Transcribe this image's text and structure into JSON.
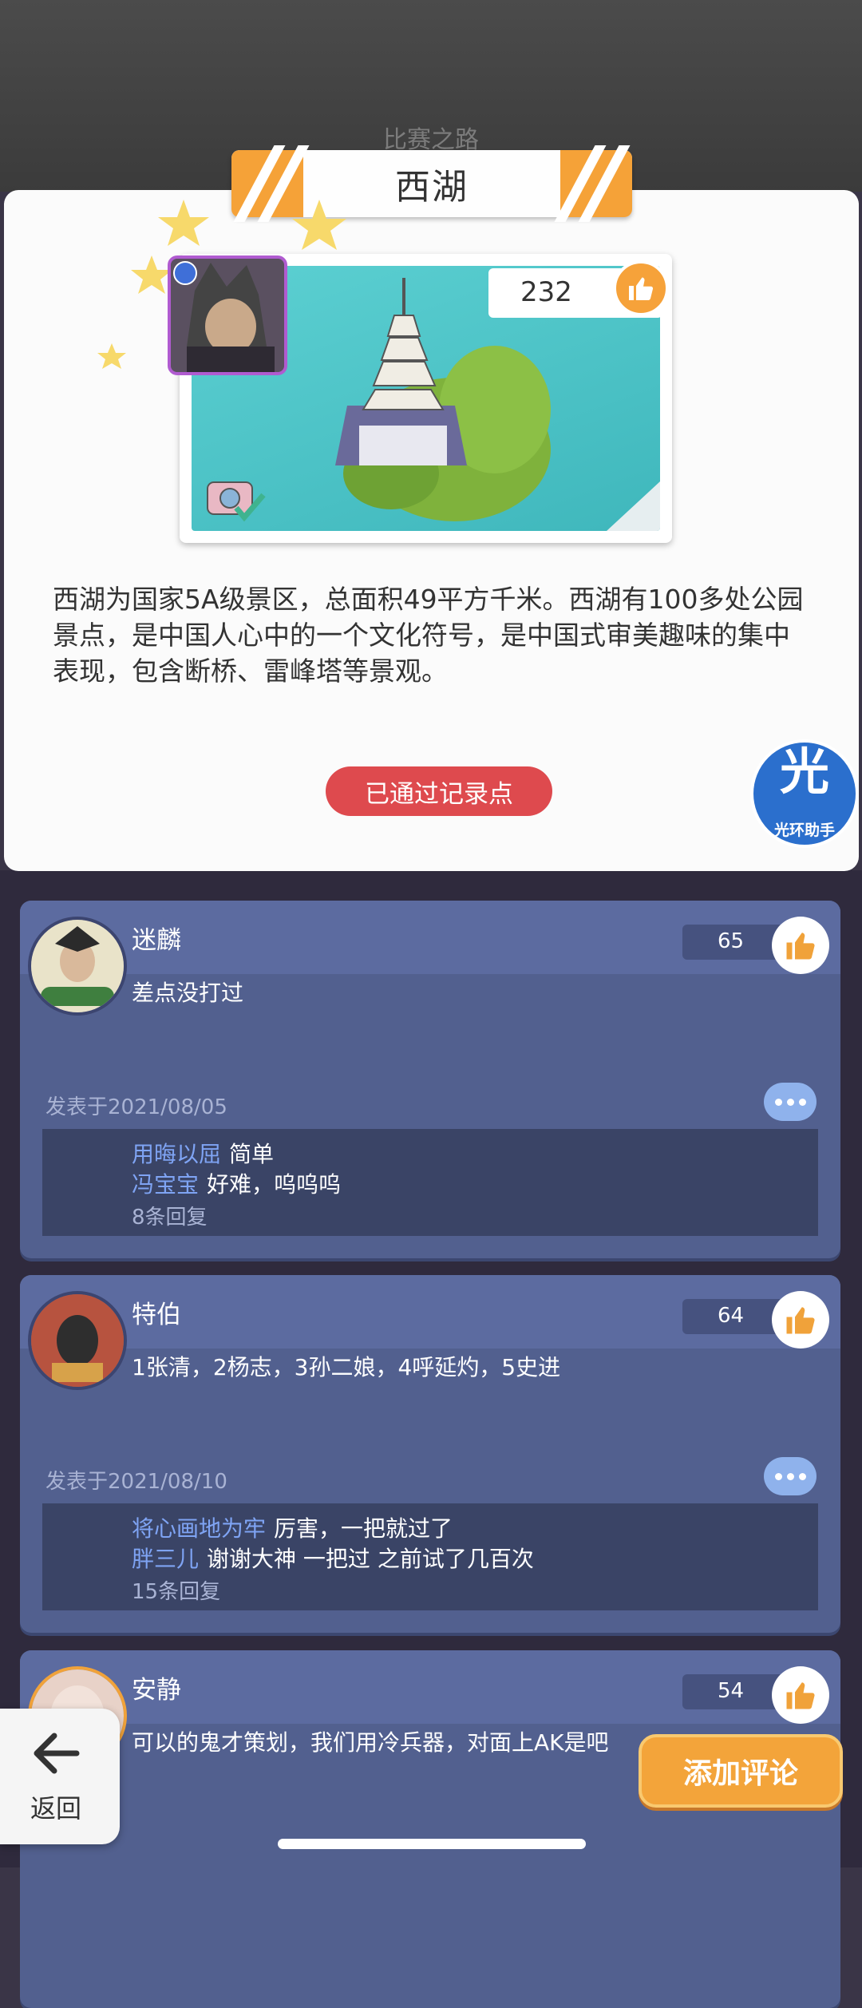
{
  "background": {
    "title": "比赛之路"
  },
  "detail": {
    "title": "西湖",
    "likes": "232",
    "description": "西湖为国家5A级景区，总面积49平方千米。西湖有100多处公园景点，是中国人心中的一个文化符号，是中国式审美趣味的集中表现，包含断桥、雷峰塔等景观。",
    "record_button": "已通过记录点",
    "assistant_icon_char": "光",
    "assistant_label": "光环助手"
  },
  "comments": [
    {
      "name": "迷麟",
      "likes": "65",
      "text": "差点没打过",
      "date": "发表于2021/08/05",
      "replies": [
        {
          "user": "用晦以屈",
          "text": "简单"
        },
        {
          "user": "冯宝宝",
          "text": "好难，呜呜呜"
        }
      ],
      "reply_count": "8条回复"
    },
    {
      "name": "特伯",
      "likes": "64",
      "text": "1张清，2杨志，3孙二娘，4呼延灼，5史进",
      "date": "发表于2021/08/10",
      "replies": [
        {
          "user": "将心画地为牢",
          "text": "厉害，一把就过了"
        },
        {
          "user": "胖三儿",
          "text": "谢谢大神  一把过  之前试了几百次"
        }
      ],
      "reply_count": "15条回复"
    },
    {
      "name": "安静",
      "likes": "54",
      "text": "可以的鬼才策划，我们用冷兵器，对面上AK是吧"
    }
  ],
  "controls": {
    "back_label": "返回",
    "add_comment_label": "添加评论"
  },
  "colors": {
    "accent_orange": "#f5a238",
    "record_red": "#de4a4e",
    "comment_card": "#52608f",
    "reply_user": "#7fa4f4"
  }
}
